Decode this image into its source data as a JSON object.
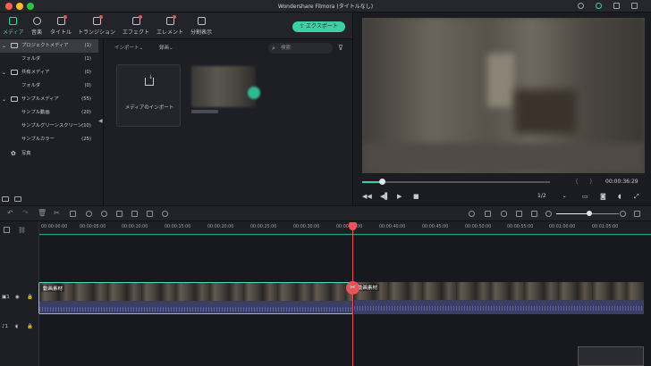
{
  "app_title": "Wondershare Filmora (タイトルなし)",
  "tabs": [
    {
      "label": "メディア",
      "icon": "folder-icon",
      "active": true
    },
    {
      "label": "音楽",
      "icon": "music-note-icon"
    },
    {
      "label": "タイトル",
      "icon": "text-icon"
    },
    {
      "label": "トランジション",
      "icon": "transition-icon"
    },
    {
      "label": "エフェクト",
      "icon": "effects-icon"
    },
    {
      "label": "エレメント",
      "icon": "element-icon"
    },
    {
      "label": "分割表示",
      "icon": "split-screen-icon"
    }
  ],
  "export_label": "エクスポート",
  "sidebar": {
    "items": [
      {
        "label": "プロジェクトメディア",
        "count": "(1)",
        "expandable": true,
        "folder": true
      },
      {
        "label": "フォルダ",
        "count": "(1)"
      },
      {
        "label": "共有メディア",
        "count": "(0)",
        "expandable": true,
        "folder": true
      },
      {
        "label": "フォルダ",
        "count": "(0)"
      },
      {
        "label": "サンプルメディア",
        "count": "(55)",
        "expandable": true,
        "folder": true
      },
      {
        "label": "サンプル動画",
        "count": "(20)"
      },
      {
        "label": "サンプルグリーンスクリーン",
        "count": "(10)"
      },
      {
        "label": "サンプルカラー",
        "count": "(25)"
      },
      {
        "label": "写真",
        "count": ""
      }
    ]
  },
  "media": {
    "import_dropdown": "インポート",
    "record_dropdown": "録画",
    "search_placeholder": "検索",
    "import_card_label": "メディアのインポート"
  },
  "preview": {
    "timecode": "00:00:36:29",
    "ratio": "1/2",
    "progress": 0.1
  },
  "ruler_labels": [
    "00:00:00:00",
    "00:00:05:00",
    "00:00:10:00",
    "00:00:15:00",
    "00:00:20:00",
    "00:00:25:00",
    "00:00:30:00",
    "00:00:35:00",
    "00:00:40:00",
    "00:00:45:00",
    "00:00:50:00",
    "00:00:55:00",
    "00:01:00:00",
    "00:01:05:00"
  ],
  "clips": [
    {
      "label": "動画素材"
    },
    {
      "label": "動画素材"
    }
  ],
  "tracks": {
    "video": "1",
    "audio": "1"
  },
  "colors": {
    "accent": "#2fd5a5",
    "playhead": "#e8545a",
    "export": "#3ecfa3"
  }
}
